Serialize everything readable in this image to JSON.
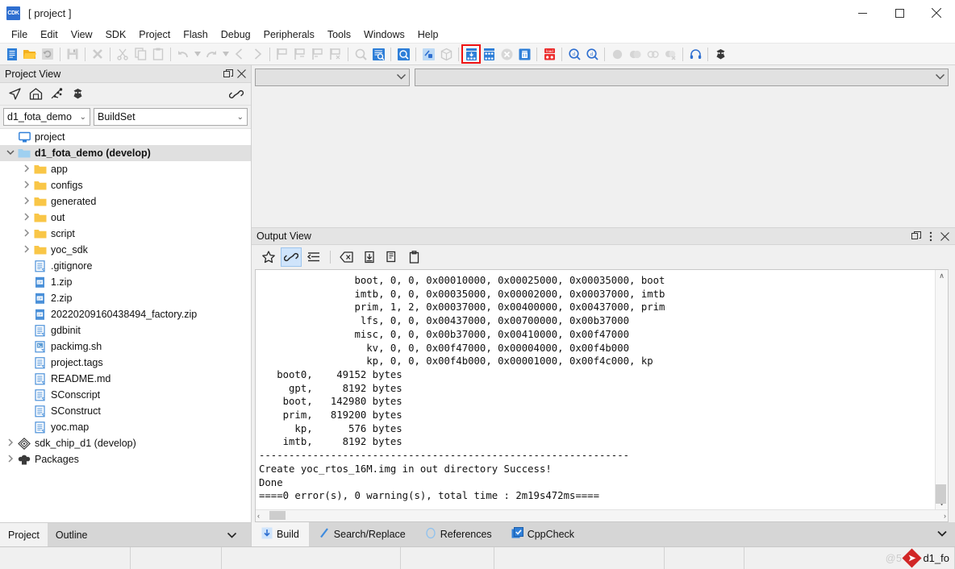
{
  "window": {
    "app_icon_text": "CDK",
    "title": "[ project ]",
    "minimize_label": "—",
    "maximize_label": "□",
    "close_label": "✕"
  },
  "menubar": {
    "items": [
      {
        "label": "File"
      },
      {
        "label": "Edit"
      },
      {
        "label": "View"
      },
      {
        "label": "SDK"
      },
      {
        "label": "Project"
      },
      {
        "label": "Flash"
      },
      {
        "label": "Debug"
      },
      {
        "label": "Peripherals"
      },
      {
        "label": "Tools"
      },
      {
        "label": "Windows"
      },
      {
        "label": "Help"
      }
    ]
  },
  "toolbar": {
    "highlight_color": "#ee1111",
    "items": [
      {
        "name": "new-file-icon",
        "enabled": true
      },
      {
        "name": "open-folder-icon",
        "enabled": true
      },
      {
        "name": "refresh-icon",
        "enabled": false
      },
      {
        "name": "separator"
      },
      {
        "name": "save-icon",
        "enabled": false
      },
      {
        "name": "separator"
      },
      {
        "name": "close-x-icon",
        "enabled": false
      },
      {
        "name": "separator"
      },
      {
        "name": "cut-icon",
        "enabled": false
      },
      {
        "name": "copy-icon",
        "enabled": false
      },
      {
        "name": "paste-icon",
        "enabled": false
      },
      {
        "name": "separator"
      },
      {
        "name": "undo-icon",
        "enabled": false
      },
      {
        "name": "undo-dropdown-icon",
        "enabled": false
      },
      {
        "name": "redo-icon",
        "enabled": false
      },
      {
        "name": "redo-dropdown-icon",
        "enabled": false
      },
      {
        "name": "nav-back-icon",
        "enabled": false
      },
      {
        "name": "nav-forward-icon",
        "enabled": false
      },
      {
        "name": "separator"
      },
      {
        "name": "bookmark-toggle-icon",
        "enabled": false
      },
      {
        "name": "bookmark-next-icon",
        "enabled": false
      },
      {
        "name": "bookmark-prev-icon",
        "enabled": false
      },
      {
        "name": "bookmark-clear-icon",
        "enabled": false
      },
      {
        "name": "separator"
      },
      {
        "name": "find-icon",
        "enabled": false
      },
      {
        "name": "find-in-files-icon",
        "enabled": true
      },
      {
        "name": "separator"
      },
      {
        "name": "search-replace-icon",
        "enabled": true
      },
      {
        "name": "separator"
      },
      {
        "name": "build-icon",
        "enabled": true
      },
      {
        "name": "package-icon",
        "enabled": false
      },
      {
        "name": "separator"
      },
      {
        "name": "flash-download-icon",
        "enabled": true,
        "highlighted": true
      },
      {
        "name": "flash-erase-icon",
        "enabled": true
      },
      {
        "name": "stop-icon",
        "enabled": false
      },
      {
        "name": "delete-icon",
        "enabled": true
      },
      {
        "name": "separator"
      },
      {
        "name": "load-icon",
        "enabled": true
      },
      {
        "name": "separator"
      },
      {
        "name": "zoom-in-icon",
        "enabled": true
      },
      {
        "name": "zoom-out-icon",
        "enabled": true
      },
      {
        "name": "separator"
      },
      {
        "name": "breakpoint-icon",
        "enabled": false
      },
      {
        "name": "breakpoints-icon",
        "enabled": false
      },
      {
        "name": "link-icon",
        "enabled": false
      },
      {
        "name": "unlink-icon",
        "enabled": false
      },
      {
        "name": "separator"
      },
      {
        "name": "debug-headset-icon",
        "enabled": true
      },
      {
        "name": "separator"
      },
      {
        "name": "terminal-icon",
        "enabled": true
      }
    ]
  },
  "project_view": {
    "title": "Project View",
    "restore_label": "❐",
    "close_label": "✕",
    "tools": [
      {
        "name": "locate-icon"
      },
      {
        "name": "home-icon"
      },
      {
        "name": "dependency-icon"
      },
      {
        "name": "terminal-icon"
      },
      {
        "name": "link-icon"
      }
    ],
    "project_combo": {
      "value": "d1_fota_demo",
      "arrow": "⌄"
    },
    "buildset_combo": {
      "value": "BuildSet",
      "arrow": "⌄"
    },
    "tree": [
      {
        "label": "project",
        "icon": "monitor-icon",
        "indent": 0,
        "arrow": "",
        "selected": false,
        "bold": false
      },
      {
        "label": "d1_fota_demo (develop)",
        "icon": "folder-blue-icon",
        "indent": 0,
        "arrow": "⌄",
        "selected": true,
        "bold": true
      },
      {
        "label": "app",
        "icon": "folder-icon",
        "indent": 1,
        "arrow": "›",
        "selected": false,
        "bold": false
      },
      {
        "label": "configs",
        "icon": "folder-icon",
        "indent": 1,
        "arrow": "›",
        "selected": false,
        "bold": false
      },
      {
        "label": "generated",
        "icon": "folder-icon",
        "indent": 1,
        "arrow": "›",
        "selected": false,
        "bold": false
      },
      {
        "label": "out",
        "icon": "folder-icon",
        "indent": 1,
        "arrow": "›",
        "selected": false,
        "bold": false
      },
      {
        "label": "script",
        "icon": "folder-icon",
        "indent": 1,
        "arrow": "›",
        "selected": false,
        "bold": false
      },
      {
        "label": "yoc_sdk",
        "icon": "folder-icon",
        "indent": 1,
        "arrow": "›",
        "selected": false,
        "bold": false
      },
      {
        "label": ".gitignore",
        "icon": "file-icon",
        "indent": 1,
        "arrow": "",
        "selected": false,
        "bold": false
      },
      {
        "label": "1.zip",
        "icon": "zip-icon",
        "indent": 1,
        "arrow": "",
        "selected": false,
        "bold": false
      },
      {
        "label": "2.zip",
        "icon": "zip-icon",
        "indent": 1,
        "arrow": "",
        "selected": false,
        "bold": false
      },
      {
        "label": "20220209160438494_factory.zip",
        "icon": "zip-icon",
        "indent": 1,
        "arrow": "",
        "selected": false,
        "bold": false
      },
      {
        "label": "gdbinit",
        "icon": "file-icon",
        "indent": 1,
        "arrow": "",
        "selected": false,
        "bold": false
      },
      {
        "label": "packimg.sh",
        "icon": "script-icon",
        "indent": 1,
        "arrow": "",
        "selected": false,
        "bold": false
      },
      {
        "label": "project.tags",
        "icon": "file-icon",
        "indent": 1,
        "arrow": "",
        "selected": false,
        "bold": false
      },
      {
        "label": "README.md",
        "icon": "file-icon",
        "indent": 1,
        "arrow": "",
        "selected": false,
        "bold": false
      },
      {
        "label": "SConscript",
        "icon": "file-icon",
        "indent": 1,
        "arrow": "",
        "selected": false,
        "bold": false
      },
      {
        "label": "SConstruct",
        "icon": "file-icon",
        "indent": 1,
        "arrow": "",
        "selected": false,
        "bold": false
      },
      {
        "label": "yoc.map",
        "icon": "file-icon",
        "indent": 1,
        "arrow": "",
        "selected": false,
        "bold": false
      },
      {
        "label": "sdk_chip_d1 (develop)",
        "icon": "chip-icon",
        "indent": 0,
        "arrow": "›",
        "selected": false,
        "bold": false
      },
      {
        "label": "Packages",
        "icon": "packages-icon",
        "indent": 0,
        "arrow": "›",
        "selected": false,
        "bold": false
      }
    ],
    "bottom_tabs": [
      {
        "label": "Project",
        "active": true
      },
      {
        "label": "Outline",
        "active": false
      }
    ],
    "bottom_caret": "⌄"
  },
  "editor": {
    "combo_left": {
      "value": "",
      "arrow": "⌄"
    },
    "combo_right": {
      "value": "",
      "arrow": "⌄"
    }
  },
  "output_view": {
    "title": "Output View",
    "restore_label": "❐",
    "menu_label": "⋮",
    "close_label": "✕",
    "tools": [
      {
        "name": "favorite-star-icon",
        "active": false
      },
      {
        "name": "link-icon",
        "active": true
      },
      {
        "name": "wrap-lines-icon",
        "active": false
      },
      {
        "name": "clear-icon",
        "active": false
      },
      {
        "name": "save-output-icon",
        "active": false
      },
      {
        "name": "copy-icon",
        "active": false
      },
      {
        "name": "paste-icon",
        "active": false
      }
    ],
    "console_text": "                boot, 0, 0, 0x00010000, 0x00025000, 0x00035000, boot\n                imtb, 0, 0, 0x00035000, 0x00002000, 0x00037000, imtb\n                prim, 1, 2, 0x00037000, 0x00400000, 0x00437000, prim\n                 lfs, 0, 0, 0x00437000, 0x00700000, 0x00b37000\n                misc, 0, 0, 0x00b37000, 0x00410000, 0x00f47000\n                  kv, 0, 0, 0x00f47000, 0x00004000, 0x00f4b000\n                  kp, 0, 0, 0x00f4b000, 0x00001000, 0x00f4c000, kp\n   boot0,    49152 bytes\n     gpt,     8192 bytes\n    boot,   142980 bytes\n    prim,   819200 bytes\n      kp,      576 bytes\n    imtb,     8192 bytes\n--------------------------------------------------------------\nCreate yoc_rtos_16M.img in out directory Success!\nDone\n====0 error(s), 0 warning(s), total time : 2m19s472ms====",
    "scroll_up": "∧",
    "scroll_down": "∨",
    "scroll_left": "‹",
    "scroll_right": "›",
    "tabs": [
      {
        "label": "Build",
        "icon": "build-down-arrow-icon",
        "active": true
      },
      {
        "label": "Search/Replace",
        "icon": "pencil-icon",
        "active": false
      },
      {
        "label": "References",
        "icon": "circle-icon",
        "active": false
      },
      {
        "label": "CppCheck",
        "icon": "checkbox-icon",
        "active": false
      }
    ],
    "tabs_caret": "⌄"
  },
  "statusbar": {
    "watermark": "@5",
    "project_label": "d1_fo"
  }
}
